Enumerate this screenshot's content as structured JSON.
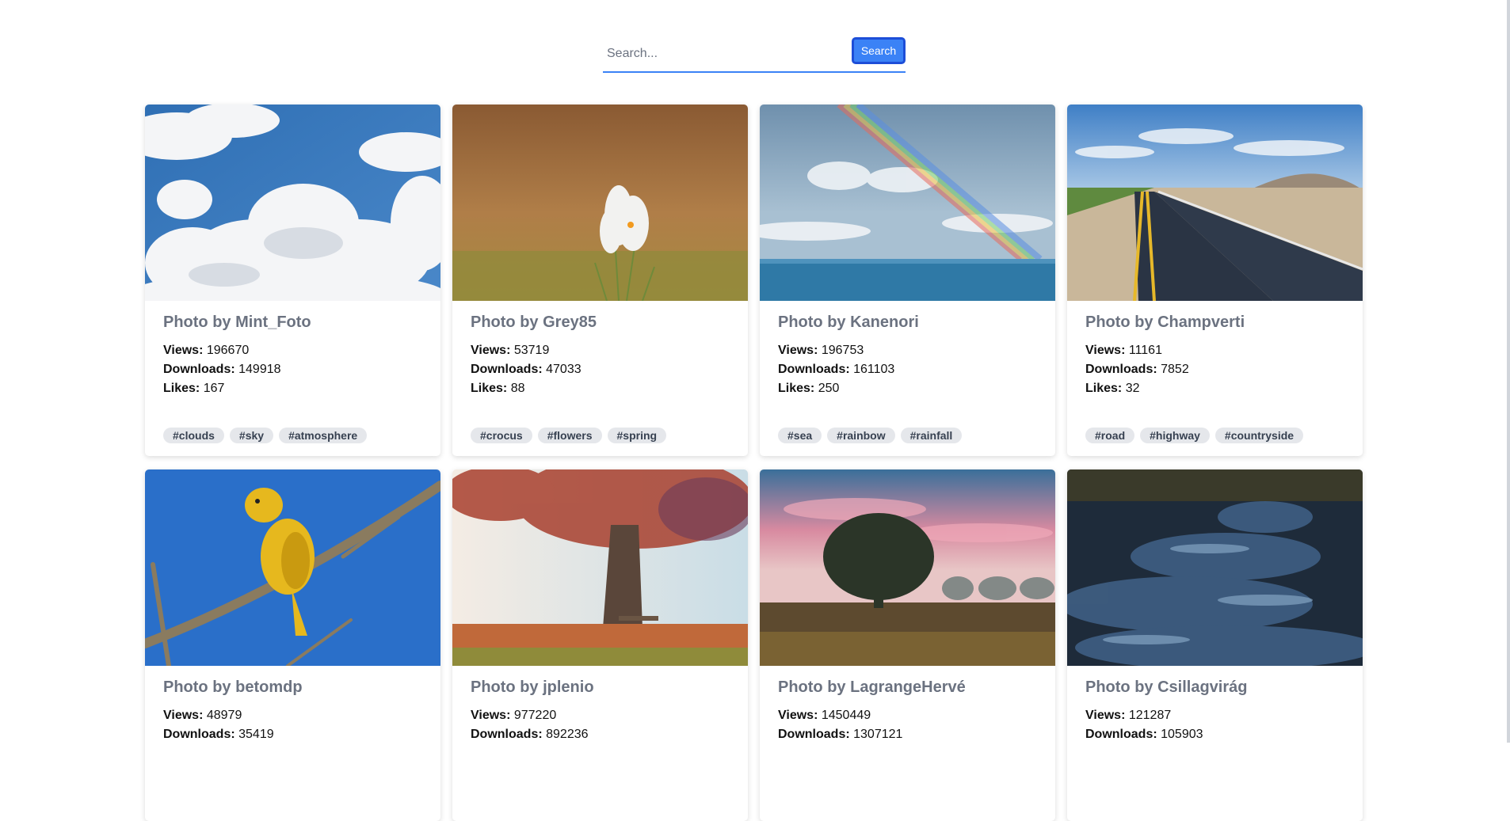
{
  "search": {
    "placeholder": "Search...",
    "value": "",
    "button_label": "Search"
  },
  "cards": [
    {
      "title": "Photo by Mint_Foto",
      "views_label": "Views:",
      "views": "196670",
      "downloads_label": "Downloads:",
      "downloads": "149918",
      "likes_label": "Likes:",
      "likes": "167",
      "tags": [
        "#clouds",
        "#sky",
        "#atmosphere"
      ]
    },
    {
      "title": "Photo by Grey85",
      "views_label": "Views:",
      "views": "53719",
      "downloads_label": "Downloads:",
      "downloads": "47033",
      "likes_label": "Likes:",
      "likes": "88",
      "tags": [
        "#crocus",
        "#flowers",
        "#spring"
      ]
    },
    {
      "title": "Photo by Kanenori",
      "views_label": "Views:",
      "views": "196753",
      "downloads_label": "Downloads:",
      "downloads": "161103",
      "likes_label": "Likes:",
      "likes": "250",
      "tags": [
        "#sea",
        "#rainbow",
        "#rainfall"
      ]
    },
    {
      "title": "Photo by Champverti",
      "views_label": "Views:",
      "views": "11161",
      "downloads_label": "Downloads:",
      "downloads": "7852",
      "likes_label": "Likes:",
      "likes": "32",
      "tags": [
        "#road",
        "#highway",
        "#countryside"
      ]
    },
    {
      "title": "Photo by betomdp",
      "views_label": "Views:",
      "views": "48979",
      "downloads_label": "Downloads:",
      "downloads": "35419"
    },
    {
      "title": "Photo by jplenio",
      "views_label": "Views:",
      "views": "977220",
      "downloads_label": "Downloads:",
      "downloads": "892236"
    },
    {
      "title": "Photo by LagrangeHervé",
      "views_label": "Views:",
      "views": "1450449",
      "downloads_label": "Downloads:",
      "downloads": "1307121"
    },
    {
      "title": "Photo by Csillagvirág",
      "views_label": "Views:",
      "views": "121287",
      "downloads_label": "Downloads:",
      "downloads": "105903"
    }
  ]
}
